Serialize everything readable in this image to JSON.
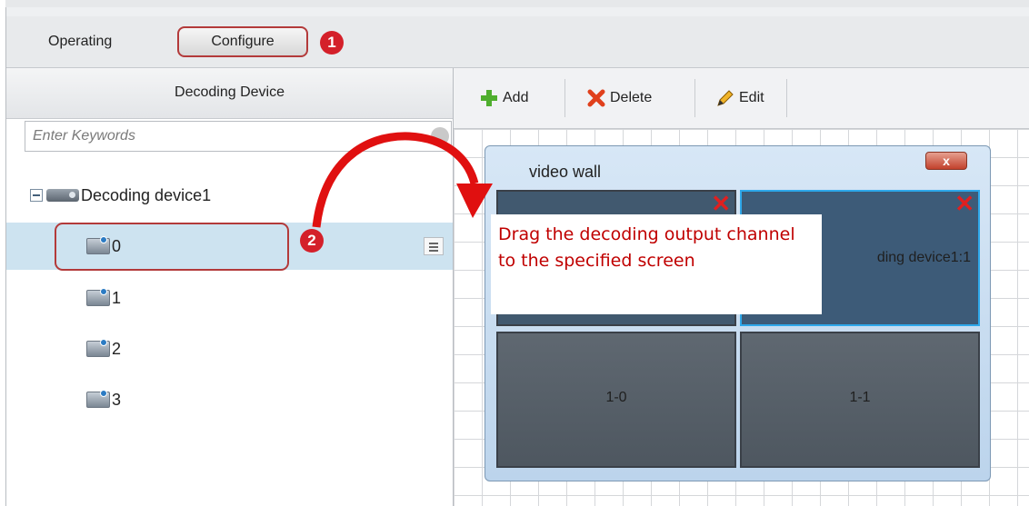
{
  "tabs": {
    "operating": "Operating",
    "configure": "Configure"
  },
  "badges": {
    "one": "1",
    "two": "2"
  },
  "left_panel": {
    "header": "Decoding Device",
    "search_placeholder": "Enter Keywords",
    "root_label": "Decoding device1",
    "channels": [
      "0",
      "1",
      "2",
      "3"
    ]
  },
  "toolbar": {
    "add": "Add",
    "delete": "Delete",
    "edit": "Edit"
  },
  "video_wall": {
    "title": "video wall",
    "close": "x",
    "screens": [
      "",
      "ding device1:1",
      "1-0",
      "1-1"
    ]
  },
  "callout": {
    "text": "Drag the decoding output channel to the specified screen"
  },
  "colors": {
    "accent_red": "#d4202a",
    "selection": "#cde3f0",
    "callout_text": "#c00000"
  }
}
